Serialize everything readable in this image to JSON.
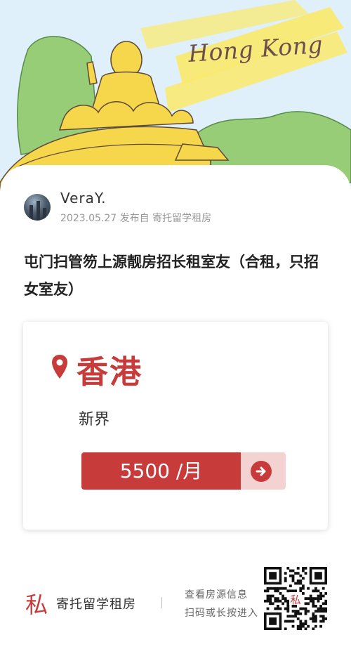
{
  "hero": {
    "title": "Hong Kong"
  },
  "author": {
    "name": "VeraY.",
    "date": "2023.05.27",
    "published_via": "发布自 寄托留学租房"
  },
  "post": {
    "title": "屯门扫管笏上源靓房招长租室友（合租，只招女室友）"
  },
  "listing": {
    "city": "香港",
    "district": "新界",
    "price": "5500 /月"
  },
  "footer": {
    "logo_glyph": "私",
    "brand": "寄托留学租房",
    "cta_line1": "查看房源信息",
    "cta_line2": "扫码或长按进入",
    "qr_center_glyph": "私"
  },
  "colors": {
    "accent": "#c73b3b",
    "accent_light": "#f4d2d2",
    "hero_sky": "#dff0fa"
  },
  "icons": [
    "location-pin-icon",
    "arrow-right-icon",
    "qr-code"
  ]
}
